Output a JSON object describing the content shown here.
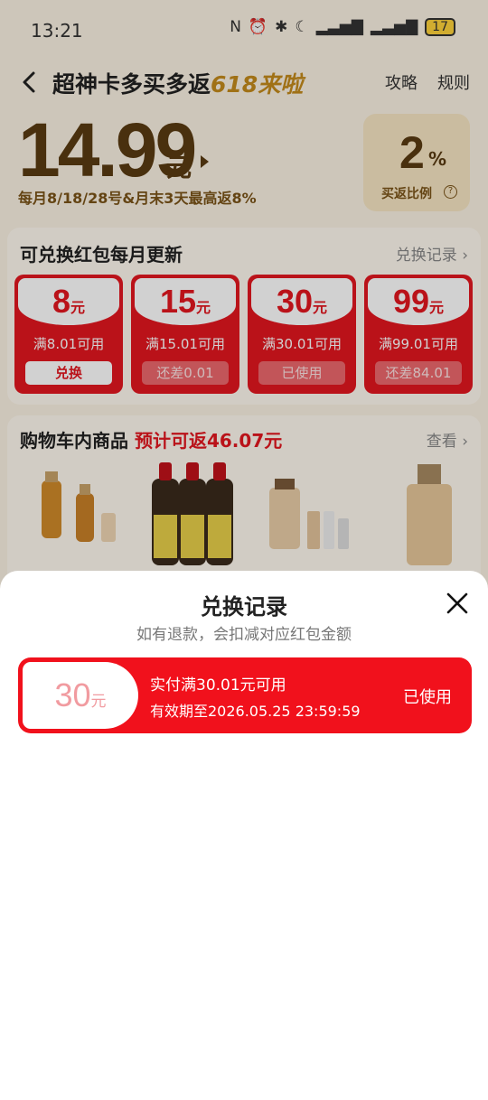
{
  "status_bar": {
    "time": "13:21",
    "battery": "17"
  },
  "header": {
    "title_main": "超神卡多买多返",
    "title_highlight": "618来啦",
    "link_guide": "攻略",
    "link_rules": "规则"
  },
  "card": {
    "price": "14.99",
    "price_unit": "元",
    "rebate_note": "每月8/18/28号&月末3天最高返8%",
    "rate_value": "2",
    "rate_unit": "%",
    "rate_label": "买返比例"
  },
  "coupons": {
    "title": "可兑换红包每月更新",
    "link": "兑换记录 ›",
    "items": [
      {
        "amount": "8",
        "unit": "元",
        "condition": "满8.01可用",
        "button": "兑换"
      },
      {
        "amount": "15",
        "unit": "元",
        "condition": "满15.01可用",
        "button": "还差0.01"
      },
      {
        "amount": "30",
        "unit": "元",
        "condition": "满30.01可用",
        "button": "已使用"
      },
      {
        "amount": "99",
        "unit": "元",
        "condition": "满99.01可用",
        "button": "还差84.01"
      }
    ]
  },
  "cart": {
    "title": "购物车内商品",
    "estimate": "预计可返46.07元",
    "link": "查看 ›",
    "products": [
      "serum-bottles",
      "soy-sauce-bottles",
      "foundation-set",
      "foundation-bottle"
    ]
  },
  "sheet": {
    "title": "兑换记录",
    "subtitle": "如有退款，会扣减对应红包金额",
    "record": {
      "amount": "30",
      "unit": "元",
      "condition": "实付满30.01元可用",
      "expiry": "有效期至2026.05.25 23:59:59",
      "status": "已使用"
    }
  },
  "colors": {
    "accent_red": "#f1111c",
    "gold": "#5a3b12"
  }
}
